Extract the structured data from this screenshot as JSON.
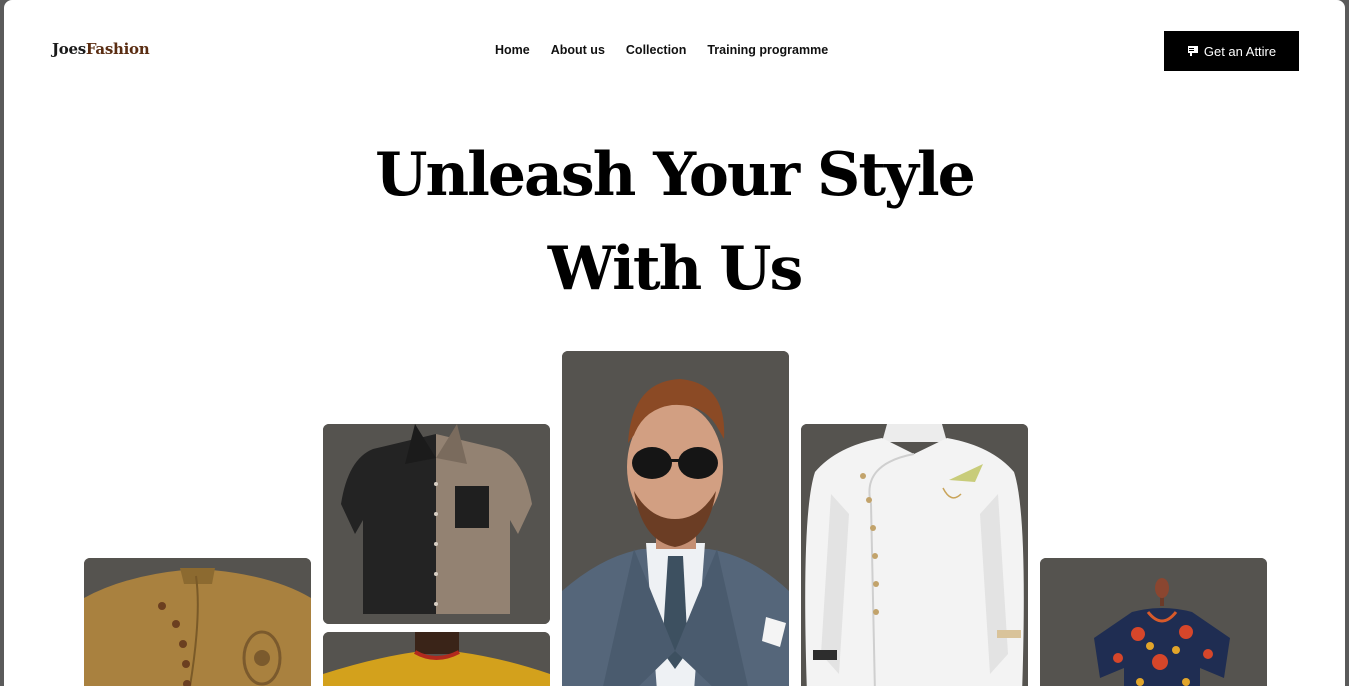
{
  "header": {
    "logo_part1": "Joes",
    "logo_part2": "Fashion",
    "nav": [
      "Home",
      "About us",
      "Collection",
      "Training programme"
    ],
    "cta_label": "Get an Attire",
    "cta_icon": "hanger-icon"
  },
  "hero": {
    "line1": "Unleash Your Style",
    "line2": "With Us"
  },
  "gallery": [
    {
      "name": "tan-senator-attire"
    },
    {
      "name": "two-tone-shirt"
    },
    {
      "name": "yellow-shirt"
    },
    {
      "name": "man-in-suit"
    },
    {
      "name": "white-senator-attire"
    },
    {
      "name": "ankara-dress"
    }
  ],
  "colors": {
    "cta_bg": "#000000",
    "card_bg": "#55534f"
  }
}
